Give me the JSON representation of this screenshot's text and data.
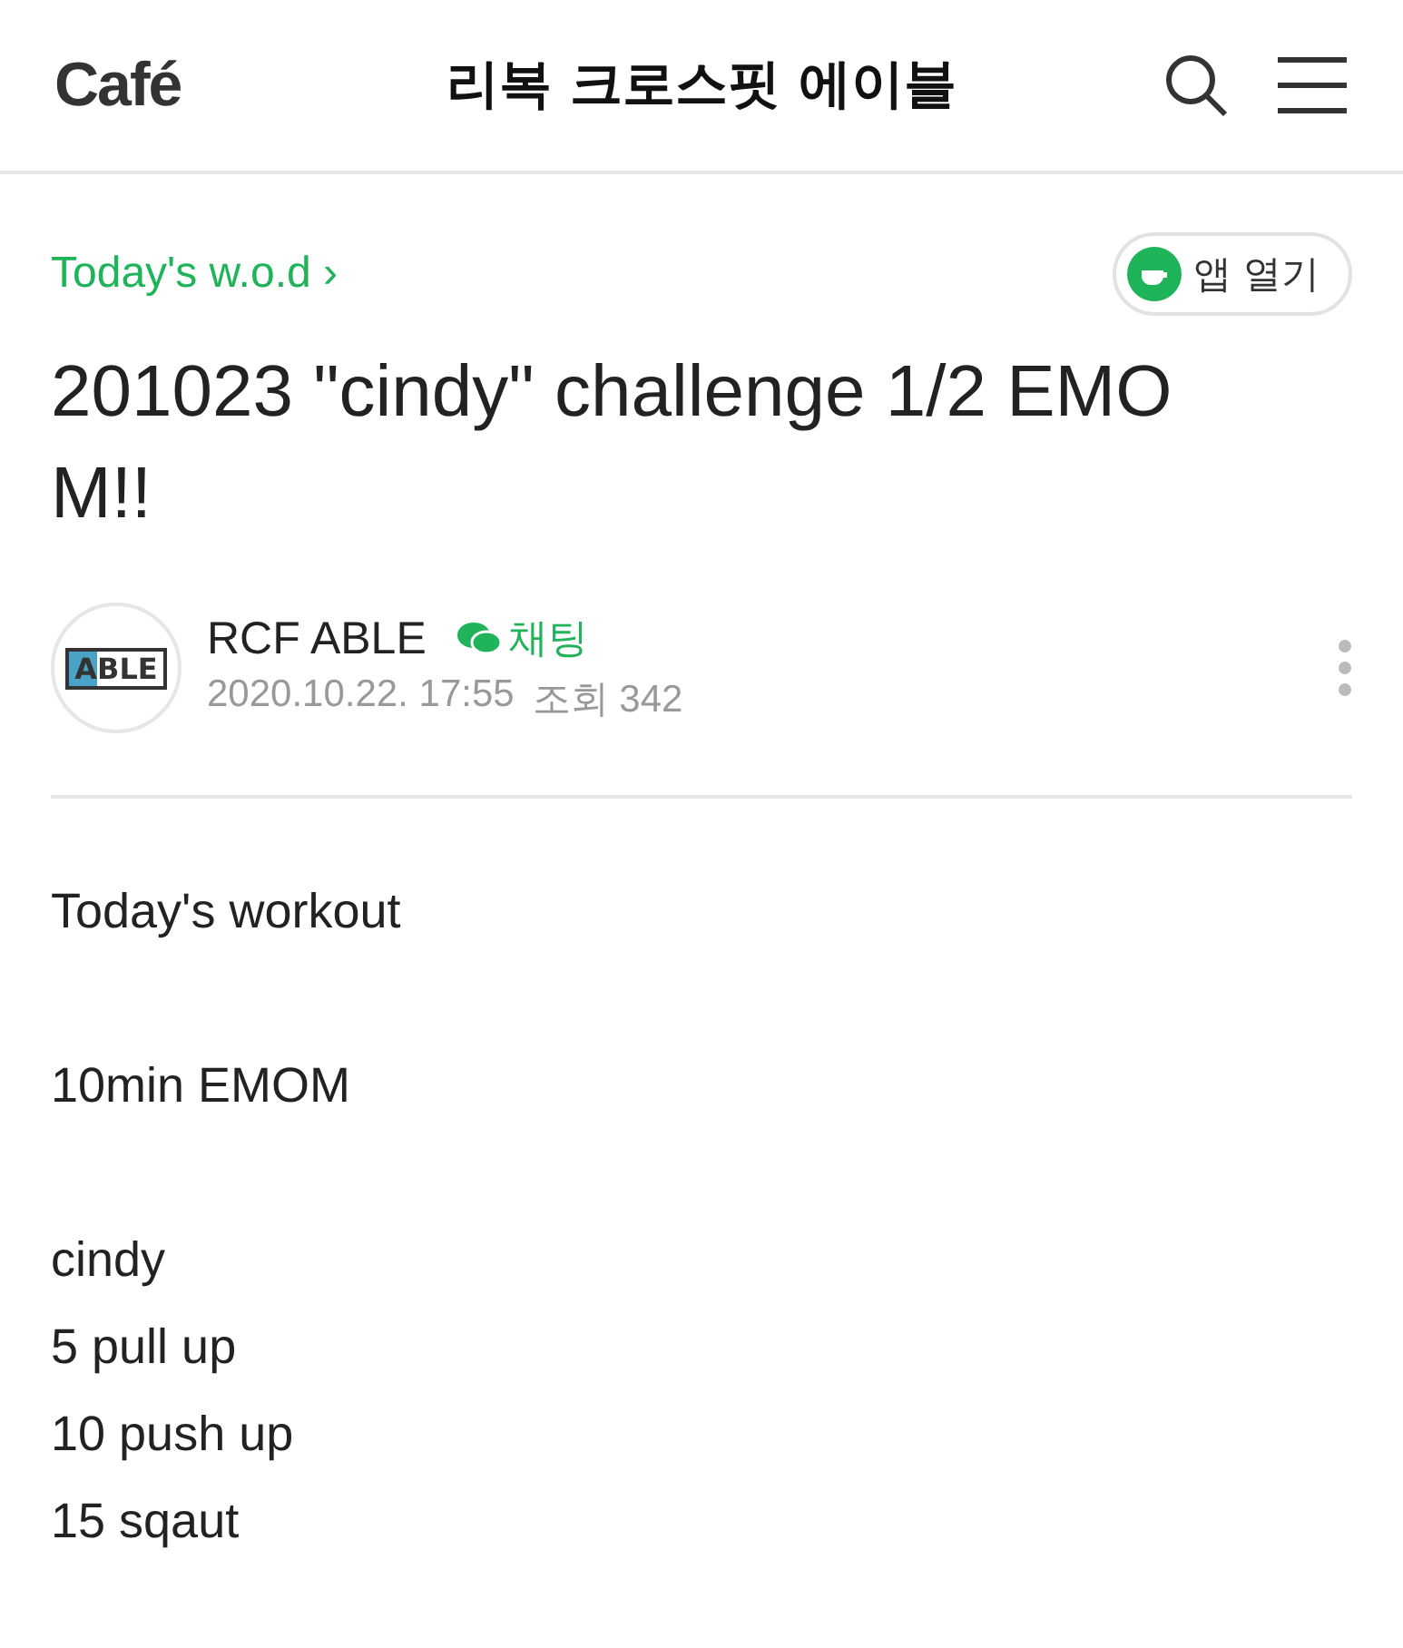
{
  "header": {
    "logo": "Café",
    "cafe_name": "리복 크로스핏 에이블"
  },
  "category": "Today's w.o.d ›",
  "open_app_button": "앱 열기",
  "title_lines": [
    "201023 \"cindy\" challenge 1/2 EMO",
    "M!!"
  ],
  "author": {
    "avatar_text": "ABLE",
    "name": "RCF ABLE",
    "chat_label": "채팅",
    "date": "2020.10.22. 17:55",
    "views": "조회 342"
  },
  "body": [
    [
      "Today's workout"
    ],
    [
      "10min EMOM"
    ],
    [
      "cindy",
      "5 pull up",
      "10 push up",
      "15 sqaut"
    ]
  ]
}
